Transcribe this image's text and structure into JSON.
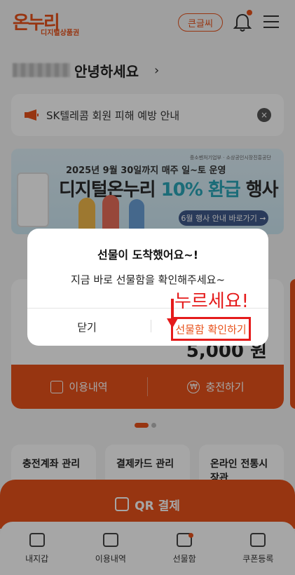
{
  "header": {
    "logo_main": "온누리",
    "logo_sub": "디지털상품권",
    "bigtext_label": "큰글씨",
    "icons": {
      "bell": "bell-icon",
      "menu": "menu-icon"
    },
    "accent_color": "#e8521b"
  },
  "greeting": {
    "text": "안녕하세요",
    "arrow": "›"
  },
  "notice": {
    "text": "SK텔레콤 회원 피해 예방 안내",
    "close_glyph": "×"
  },
  "banner": {
    "orgs": "중소벤처기업부 · 소상공인시장진흥공단",
    "line1": "2025년 9월 30일까지 매주 일~토 운영",
    "line2_part1": "디지털온누리 ",
    "line2_highlight": "10% 환급",
    "line2_part2": " 행사",
    "cta": "6월 행사 안내 바로가기 ➞"
  },
  "card": {
    "amount": "5,000 원",
    "history_label": "이용내역",
    "charge_label": "충전하기"
  },
  "tiles": [
    {
      "label": "충전계좌 관리"
    },
    {
      "label": "결제카드 관리"
    },
    {
      "label": "온라인 전통시장관"
    }
  ],
  "qr": {
    "label": "QR 결제"
  },
  "bottom_nav": [
    {
      "label": "내지갑",
      "icon": "wallet-icon"
    },
    {
      "label": "이용내역",
      "icon": "receipt-icon"
    },
    {
      "label": "선물함",
      "icon": "gift-icon",
      "has_badge": true
    },
    {
      "label": "쿠폰등록",
      "icon": "coupon-icon"
    }
  ],
  "dialog": {
    "title": "선물이 도착했어요~!",
    "message": "지금 바로 선물함을 확인해주세요~",
    "close_label": "닫기",
    "confirm_label": "선물함 확인하기"
  },
  "annotation": {
    "text": "누르세요!",
    "color": "#e51b1b"
  }
}
